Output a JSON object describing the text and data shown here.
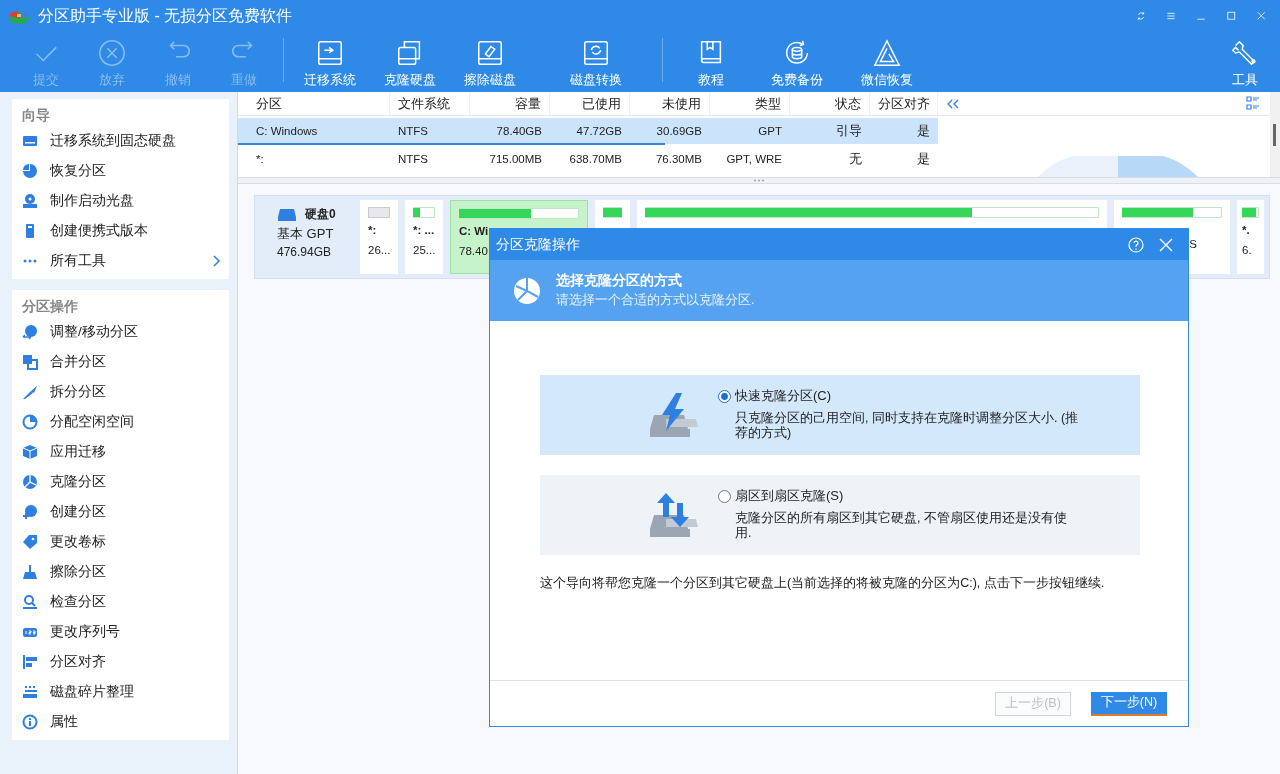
{
  "window": {
    "title": "分区助手专业版 - 无损分区免费软件"
  },
  "toolbar": {
    "items": [
      {
        "label": "提交",
        "disabled": true
      },
      {
        "label": "放弃",
        "disabled": true
      },
      {
        "label": "撤销",
        "disabled": true
      },
      {
        "label": "重做",
        "disabled": true
      },
      {
        "label": "迁移系统",
        "disabled": false
      },
      {
        "label": "克隆硬盘",
        "disabled": false
      },
      {
        "label": "擦除磁盘",
        "disabled": false
      },
      {
        "label": "磁盘转换",
        "disabled": false
      },
      {
        "label": "教程",
        "disabled": false
      },
      {
        "label": "免费备份",
        "disabled": false
      },
      {
        "label": "微信恢复",
        "disabled": false
      },
      {
        "label": "工具",
        "disabled": false
      }
    ]
  },
  "sidebar": {
    "sections": [
      {
        "title": "向导",
        "items": [
          {
            "label": "迁移系统到固态硬盘",
            "has_submenu": false
          },
          {
            "label": "恢复分区",
            "has_submenu": false
          },
          {
            "label": "制作启动光盘",
            "has_submenu": false
          },
          {
            "label": "创建便携式版本",
            "has_submenu": false
          },
          {
            "label": "所有工具",
            "has_submenu": true
          }
        ]
      },
      {
        "title": "分区操作",
        "items": [
          {
            "label": "调整/移动分区",
            "has_submenu": false
          },
          {
            "label": "合并分区",
            "has_submenu": false
          },
          {
            "label": "拆分分区",
            "has_submenu": false
          },
          {
            "label": "分配空闲空间",
            "has_submenu": false
          },
          {
            "label": "应用迁移",
            "has_submenu": false
          },
          {
            "label": "克隆分区",
            "has_submenu": false
          },
          {
            "label": "创建分区",
            "has_submenu": false
          },
          {
            "label": "更改卷标",
            "has_submenu": false
          },
          {
            "label": "擦除分区",
            "has_submenu": false
          },
          {
            "label": "检查分区",
            "has_submenu": false
          },
          {
            "label": "更改序列号",
            "has_submenu": false
          },
          {
            "label": "分区对齐",
            "has_submenu": false
          },
          {
            "label": "磁盘碎片整理",
            "has_submenu": false
          },
          {
            "label": "属性",
            "has_submenu": false
          }
        ]
      }
    ]
  },
  "partition_table": {
    "columns": [
      "分区",
      "文件系统",
      "容量",
      "已使用",
      "未使用",
      "类型",
      "状态",
      "分区对齐"
    ],
    "rows": [
      {
        "cells": [
          "C: Windows",
          "NTFS",
          "78.40GB",
          "47.72GB",
          "30.69GB",
          "GPT",
          "引导",
          "是"
        ],
        "selected": true,
        "level": 0.61
      },
      {
        "cells": [
          "*:",
          "NTFS",
          "715.00MB",
          "638.70MB",
          "76.30MB",
          "GPT, WRE",
          "无",
          "是"
        ],
        "selected": false
      }
    ]
  },
  "disk_map": {
    "disk": {
      "name": "硬盘0",
      "type": "基本 GPT",
      "size": "476.94GB"
    },
    "partitions": [
      {
        "label": "*:",
        "size": "26...",
        "unallocated": true,
        "selected": false
      },
      {
        "label": "*: ...",
        "size": "25...",
        "unallocated": false,
        "level": 0.3,
        "selected": false
      },
      {
        "label": "C: Wi",
        "size": "78.40",
        "unallocated": false,
        "level": 0.6,
        "selected": true
      },
      {
        "unallocated": false,
        "level": 1,
        "selected": false
      },
      {
        "unallocated": false,
        "level": 0.72,
        "selected": false
      },
      {
        "size": "S",
        "unallocated": false,
        "level": 0.71,
        "selected": false
      },
      {
        "label": "*.",
        "size": "6.",
        "unallocated": false,
        "level": 0.8,
        "selected": false
      }
    ]
  },
  "dialog": {
    "title": "分区克隆操作",
    "heading": "选择克隆分区的方式",
    "subheading": "请选择一个合适的方式以克隆分区.",
    "options": [
      {
        "label": "快速克隆分区(C)",
        "description": "只克隆分区的己用空间, 同时支持在克隆时调整分区大小. (推荐的方式)",
        "selected": true
      },
      {
        "label": "扇区到扇区克隆(S)",
        "description": "克隆分区的所有扇区到其它硬盘, 不管扇区使用还是没有使用.",
        "selected": false
      }
    ],
    "note": "这个导向将帮您克隆一个分区到其它硬盘上(当前选择的将被克隆的分区为C:), 点击下一步按钮继续.",
    "buttons": [
      {
        "label": "上一步(B)",
        "disabled": true
      },
      {
        "label": "下一步(N)",
        "disabled": false
      }
    ]
  }
}
